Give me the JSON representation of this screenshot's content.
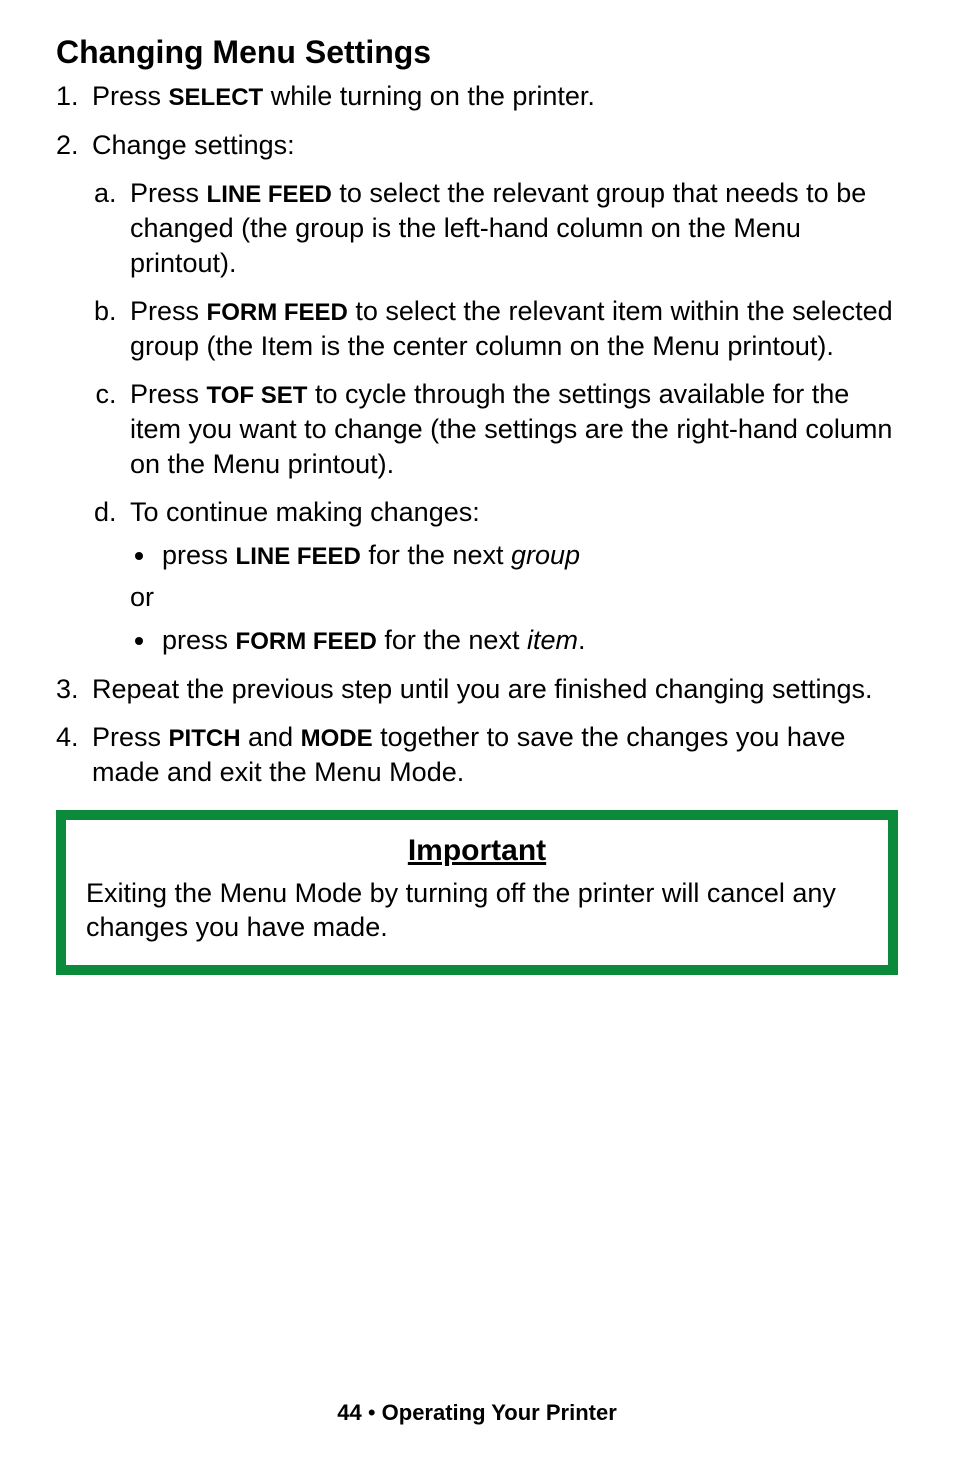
{
  "title": "Changing Menu Settings",
  "steps": {
    "s1_a": "Press ",
    "s1_key": "SELECT",
    "s1_b": " while turning on the printer.",
    "s2": "Change settings:",
    "sub": {
      "a_a": "Press ",
      "a_key": "LINE FEED",
      "a_b": " to select the relevant group that needs to be changed (the group is the left-hand column on the Menu printout).",
      "b_a": "Press ",
      "b_key": "FORM FEED",
      "b_b": " to select the relevant item within the selected group (the Item is the center column on the Menu printout).",
      "c_a": "Press ",
      "c_key": "TOF SET",
      "c_b": " to cycle through the settings available for the item you want to change (the settings are the right-hand column on the Menu printout).",
      "d": "To continue making changes:",
      "d_bul1_a": "press ",
      "d_bul1_key": "LINE FEED",
      "d_bul1_b": " for the next ",
      "d_bul1_ital": "group",
      "d_or": "or",
      "d_bul2_a": "press ",
      "d_bul2_key": "FORM FEED",
      "d_bul2_b": " for the next ",
      "d_bul2_ital": "item",
      "d_bul2_c": "."
    },
    "s3": "Repeat the previous step until you are finished changing settings.",
    "s4_a": "Press ",
    "s4_key1": "PITCH",
    "s4_b": " and ",
    "s4_key2": "MODE",
    "s4_c": " together to save the changes you have made and exit the Menu Mode."
  },
  "callout": {
    "heading": "Important",
    "body": "Exiting the Menu Mode by turning off the printer will cancel any changes you have made."
  },
  "footer": {
    "page": "44",
    "bullet": "  •  ",
    "section": "Operating Your Printer"
  }
}
